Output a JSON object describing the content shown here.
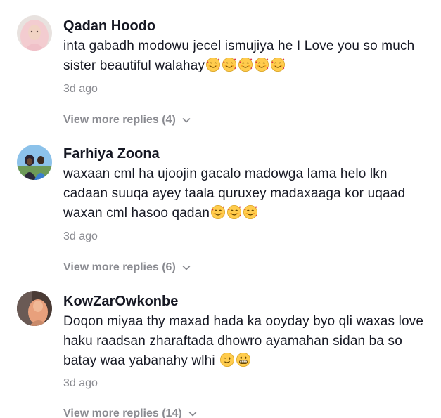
{
  "comments": [
    {
      "username": "Qadan Hoodo",
      "text": "inta gabadh modowu jecel ismujiya he I Love you so much sister beautiful walahay",
      "emojis": [
        "smiling-face-with-hearts",
        "smiling-face-with-hearts",
        "smiling-face-with-hearts",
        "smiling-face-with-hearts",
        "smiling-face-with-hearts"
      ],
      "date": "3d ago",
      "replies_label": "View more replies (4)"
    },
    {
      "username": "Farhiya Zoona",
      "text": "waxaan cml ha ujoojin gacalo madowga lama helo lkn cadaan suuqa ayey taala quruxey madaxaaga kor uqaad waxan cml hasoo qadan",
      "emojis": [
        "smiling-face-with-hearts",
        "smiling-face-with-hearts",
        "smiling-face-with-hearts"
      ],
      "date": "3d ago",
      "replies_label": "View more replies (6)"
    },
    {
      "username": "KowZarOwkonbe",
      "text": "Doqon miyaa thy maxad hada ka ooyday byo qli waxas love haku raadsan zharaftada dhowro ayamahan sidan ba so batay waa yabanahy wlhi ",
      "emojis": [
        "winking-face",
        "grimacing-face"
      ],
      "date": "3d ago",
      "replies_label": "View more replies (14)"
    }
  ],
  "colors": {
    "username": "#161823",
    "text": "#161823",
    "meta": "#8a8b91",
    "emoji_face": "#FFCC4D"
  }
}
